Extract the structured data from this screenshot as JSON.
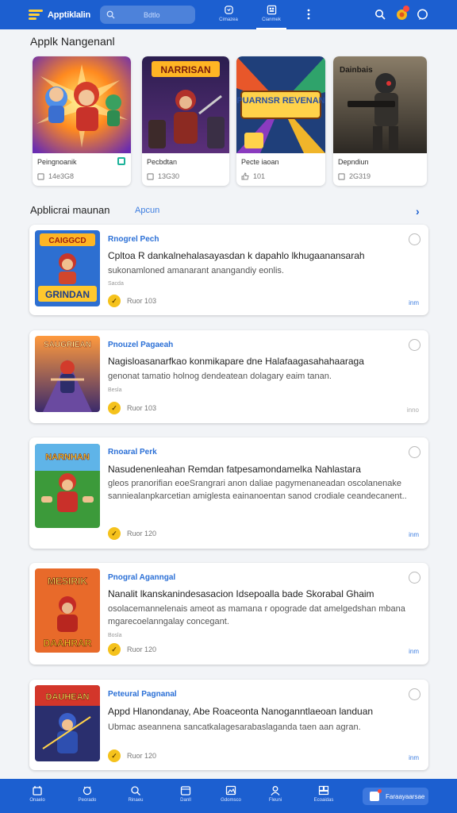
{
  "header": {
    "app_name": "Apptiklalin",
    "search_placeholder": "Bdtlo",
    "tabs": [
      {
        "label": "Cimazea",
        "icon": "shield-icon"
      },
      {
        "label": "Cianmek",
        "icon": "apps-icon",
        "active": true
      }
    ],
    "menu_icon": "more-vertical-icon",
    "actions": [
      "search-icon",
      "notification-icon",
      "chat-icon"
    ]
  },
  "featured": {
    "title": "Applk Nangenanl",
    "items": [
      {
        "name": "Peingnoanik",
        "meta": "14e3G8",
        "banner": ""
      },
      {
        "name": "Pecbdtan",
        "meta": "13G30",
        "banner": "NARRISAN"
      },
      {
        "name": "Pecte iaoan",
        "meta": "101",
        "banner": "PUARNSR REVENAN"
      },
      {
        "name": "Depndiun",
        "meta": "2G319",
        "banner": "Dainbais"
      }
    ]
  },
  "list_section": {
    "title": "Apblicrai maunan",
    "see_all": "Apcun",
    "items": [
      {
        "category": "Rnogrel Pech",
        "title": "Cpltoa R dankalnehalasayasdan k dapahlo lkhugaanansarah",
        "desc": "sukonamloned amanarant anangandiy eonlis.",
        "small": "Sacda",
        "rating": "Ruor 103",
        "more": "inm",
        "banner_top": "CAIGGCD",
        "banner_bottom": "GRINDAN"
      },
      {
        "category": "Pnouzel Pagaeah",
        "title": "Nagisloasanarfkao konmikapare dne Halafaagasahahaaraga",
        "desc": "genonat tamatio holnog dendeatean dolagary eaim tanan.",
        "small": "Besla",
        "rating": "Ruor 103",
        "more": "inno",
        "banner_top": "SAUGRIEAN",
        "banner_bottom": ""
      },
      {
        "category": "Rnoaral Perk",
        "title": "Nasudenenleahan Remdan fatpesamondamelka Nahlastara",
        "desc": "gleos pranorifian eoeSrangrari anon daliae pagymenaneadan oscolanenake sanniealanpkarcetian amiglesta eainanoentan sanod crodiale ceandecanent..",
        "small": "",
        "rating": "Ruor 120",
        "more": "inm",
        "banner_top": "NARNHAN",
        "banner_bottom": ""
      },
      {
        "category": "Pnogral Aganngal",
        "title": "Nanalit lkanskanindesasacion Idsepoalla bade Skorabal Ghaim",
        "desc": "osolacemannelenais ameot as mamana r opograde dat amelgedshan mbana mgarecoelanngalay concegant.",
        "small": "Bosla",
        "rating": "Ruor 120",
        "more": "inm",
        "banner_top": "MESIRIK",
        "banner_bottom": "DAAHRAR"
      },
      {
        "category": "Peteural Pagnanal",
        "title": "Appd Hlanondanay, Abe Roaceonta Nanoganntlaeoan landuan",
        "desc": "Ubmac aseannena sancatkalagesarabaslaganda taen aan agran.",
        "small": "",
        "rating": "Ruor 120",
        "more": "inm",
        "banner_top": "DAUHEAN",
        "banner_bottom": ""
      }
    ]
  },
  "bottom_nav": {
    "items": [
      {
        "label": "Onaelo",
        "icon": "home-icon"
      },
      {
        "label": "Peorado",
        "icon": "bug-icon"
      },
      {
        "label": "Rinaeu",
        "icon": "search-icon"
      },
      {
        "label": "Danll",
        "icon": "calendar-icon"
      },
      {
        "label": "Gdomsco",
        "icon": "image-icon"
      },
      {
        "label": "Fleuni",
        "icon": "user-icon"
      },
      {
        "label": "Ecoaidas",
        "icon": "gallery-icon"
      }
    ],
    "cta_label": "Faraayaarsae"
  },
  "colors": {
    "brand": "#1c5fd0",
    "accent": "#3d7de0",
    "coin": "#f5c21c",
    "background": "#f2f4f7"
  }
}
